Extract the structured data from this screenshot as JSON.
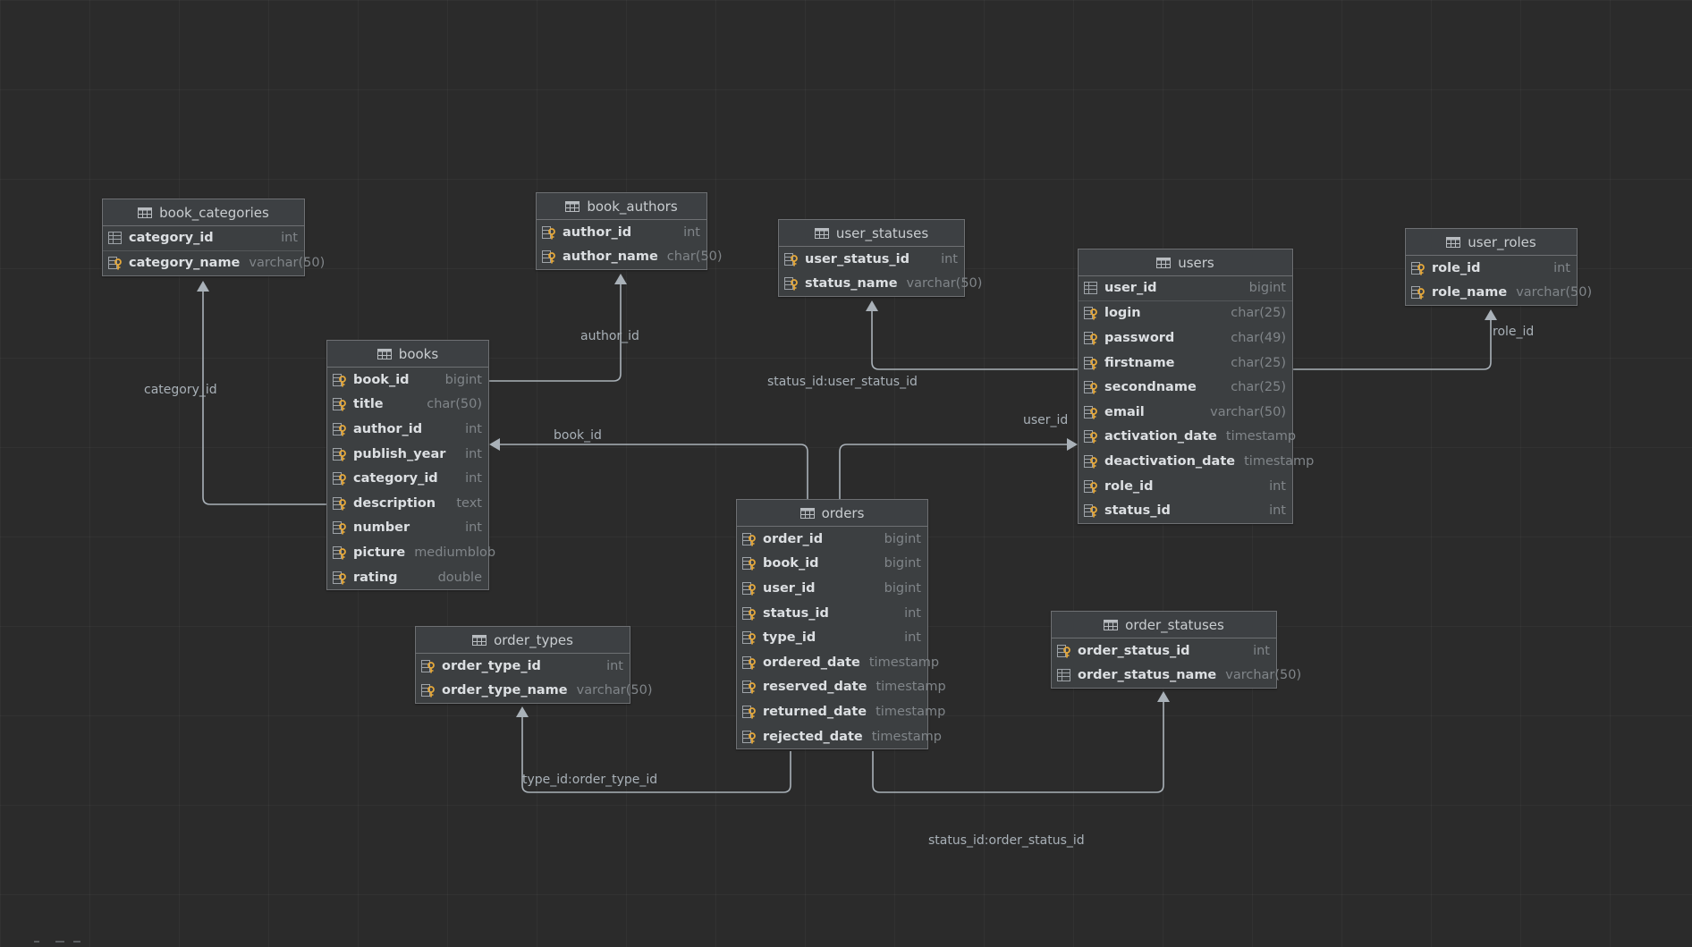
{
  "tables": [
    {
      "id": "book_categories",
      "name": "book_categories",
      "columns": [
        {
          "name": "category_id",
          "type": "int",
          "key": "pk"
        },
        {
          "name": "category_name",
          "type": "varchar(50)",
          "key": "col"
        }
      ]
    },
    {
      "id": "book_authors",
      "name": "book_authors",
      "columns": [
        {
          "name": "author_id",
          "type": "int",
          "key": "col"
        },
        {
          "name": "author_name",
          "type": "char(50)",
          "key": "col"
        }
      ]
    },
    {
      "id": "user_statuses",
      "name": "user_statuses",
      "columns": [
        {
          "name": "user_status_id",
          "type": "int",
          "key": "col"
        },
        {
          "name": "status_name",
          "type": "varchar(50)",
          "key": "col"
        }
      ]
    },
    {
      "id": "users",
      "name": "users",
      "columns": [
        {
          "name": "user_id",
          "type": "bigint",
          "key": "pk"
        },
        {
          "name": "login",
          "type": "char(25)",
          "key": "col"
        },
        {
          "name": "password",
          "type": "char(49)",
          "key": "col"
        },
        {
          "name": "firstname",
          "type": "char(25)",
          "key": "col"
        },
        {
          "name": "secondname",
          "type": "char(25)",
          "key": "col"
        },
        {
          "name": "email",
          "type": "varchar(50)",
          "key": "col"
        },
        {
          "name": "activation_date",
          "type": "timestamp",
          "key": "col"
        },
        {
          "name": "deactivation_date",
          "type": "timestamp",
          "key": "col"
        },
        {
          "name": "role_id",
          "type": "int",
          "key": "col"
        },
        {
          "name": "status_id",
          "type": "int",
          "key": "col"
        }
      ]
    },
    {
      "id": "user_roles",
      "name": "user_roles",
      "columns": [
        {
          "name": "role_id",
          "type": "int",
          "key": "col"
        },
        {
          "name": "role_name",
          "type": "varchar(50)",
          "key": "col"
        }
      ]
    },
    {
      "id": "books",
      "name": "books",
      "columns": [
        {
          "name": "book_id",
          "type": "bigint",
          "key": "col"
        },
        {
          "name": "title",
          "type": "char(50)",
          "key": "col"
        },
        {
          "name": "author_id",
          "type": "int",
          "key": "col"
        },
        {
          "name": "publish_year",
          "type": "int",
          "key": "col"
        },
        {
          "name": "category_id",
          "type": "int",
          "key": "col"
        },
        {
          "name": "description",
          "type": "text",
          "key": "col"
        },
        {
          "name": "number",
          "type": "int",
          "key": "col"
        },
        {
          "name": "picture",
          "type": "mediumblob",
          "key": "col"
        },
        {
          "name": "rating",
          "type": "double",
          "key": "col"
        }
      ]
    },
    {
      "id": "orders",
      "name": "orders",
      "columns": [
        {
          "name": "order_id",
          "type": "bigint",
          "key": "col"
        },
        {
          "name": "book_id",
          "type": "bigint",
          "key": "col"
        },
        {
          "name": "user_id",
          "type": "bigint",
          "key": "col"
        },
        {
          "name": "status_id",
          "type": "int",
          "key": "col"
        },
        {
          "name": "type_id",
          "type": "int",
          "key": "col"
        },
        {
          "name": "ordered_date",
          "type": "timestamp",
          "key": "col"
        },
        {
          "name": "reserved_date",
          "type": "timestamp",
          "key": "col"
        },
        {
          "name": "returned_date",
          "type": "timestamp",
          "key": "col"
        },
        {
          "name": "rejected_date",
          "type": "timestamp",
          "key": "col"
        }
      ]
    },
    {
      "id": "order_types",
      "name": "order_types",
      "columns": [
        {
          "name": "order_type_id",
          "type": "int",
          "key": "col"
        },
        {
          "name": "order_type_name",
          "type": "varchar(50)",
          "key": "col"
        }
      ]
    },
    {
      "id": "order_statuses",
      "name": "order_statuses",
      "columns": [
        {
          "name": "order_status_id",
          "type": "int",
          "key": "col"
        },
        {
          "name": "order_status_name",
          "type": "varchar(50)",
          "key": "pk"
        }
      ]
    }
  ],
  "relations": [
    {
      "id": "rel-category",
      "from": "books",
      "to": "book_categories",
      "label": "category_id"
    },
    {
      "id": "rel-author",
      "from": "books",
      "to": "book_authors",
      "label": "author_id"
    },
    {
      "id": "rel-book",
      "from": "orders",
      "to": "books",
      "label": "book_id"
    },
    {
      "id": "rel-user",
      "from": "orders",
      "to": "users",
      "label": "user_id"
    },
    {
      "id": "rel-user-status",
      "from": "users",
      "to": "user_statuses",
      "label": "status_id:user_status_id"
    },
    {
      "id": "rel-role",
      "from": "users",
      "to": "user_roles",
      "label": "role_id"
    },
    {
      "id": "rel-order-type",
      "from": "orders",
      "to": "order_types",
      "label": "type_id:order_type_id"
    },
    {
      "id": "rel-order-status",
      "from": "orders",
      "to": "order_statuses",
      "label": "status_id:order_status_id"
    }
  ],
  "colors": {
    "background": "#2b2b2b",
    "table_body": "#3c3f41",
    "table_border": "#6e7073",
    "column_name": "#dcdfe2",
    "column_type": "#808589",
    "connector": "#a9b1b8",
    "key_icon": "#e5a83a"
  }
}
